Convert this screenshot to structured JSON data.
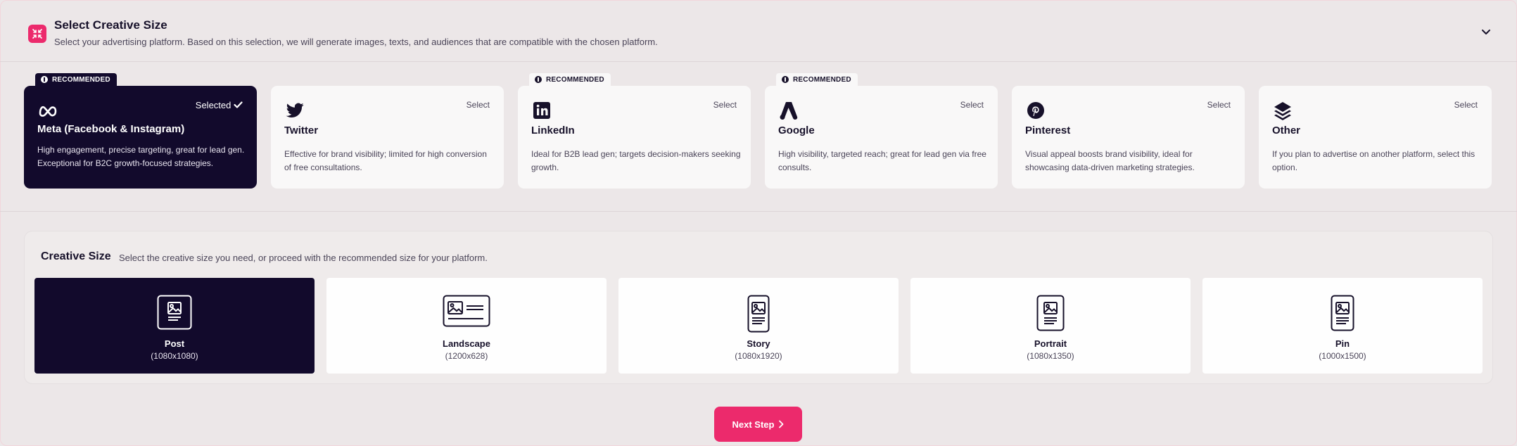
{
  "header": {
    "title": "Select Creative Size",
    "subtitle": "Select your advertising platform. Based on this selection, we will generate images, texts, and audiences that are compatible with the chosen platform.",
    "icon": "shrink-arrows-icon",
    "collapse_icon": "chevron-down-icon"
  },
  "platforms": [
    {
      "name": "Meta (Facebook & Instagram)",
      "select_label": "Selected",
      "selected": true,
      "badge": "RECOMMENDED",
      "icon": "meta-icon",
      "desc": "High engagement, precise targeting, great for lead gen. Exceptional for B2C growth-focused strategies."
    },
    {
      "name": "Twitter",
      "select_label": "Select",
      "selected": false,
      "badge": "",
      "icon": "twitter-icon",
      "desc": "Effective for brand visibility; limited for high conversion of free consultations."
    },
    {
      "name": "LinkedIn",
      "select_label": "Select",
      "selected": false,
      "badge": "RECOMMENDED",
      "icon": "linkedin-icon",
      "desc": "Ideal for B2B lead gen; targets decision-makers seeking growth."
    },
    {
      "name": "Google",
      "select_label": "Select",
      "selected": false,
      "badge": "RECOMMENDED",
      "icon": "google-ads-icon",
      "desc": "High visibility, targeted reach; great for lead gen via free consults."
    },
    {
      "name": "Pinterest",
      "select_label": "Select",
      "selected": false,
      "badge": "",
      "icon": "pinterest-icon",
      "desc": "Visual appeal boosts brand visibility, ideal for showcasing data-driven marketing strategies."
    },
    {
      "name": "Other",
      "select_label": "Select",
      "selected": false,
      "badge": "",
      "icon": "layers-icon",
      "desc": "If you plan to advertise on another platform, select this option."
    }
  ],
  "creative_size": {
    "title": "Creative Size",
    "subtitle": "Select the creative size you need, or proceed with the recommended size for your platform.",
    "sizes": [
      {
        "name": "Post",
        "dims": "(1080x1080)",
        "selected": true,
        "icon": "post-image-icon"
      },
      {
        "name": "Landscape",
        "dims": "(1200x628)",
        "selected": false,
        "icon": "landscape-image-icon"
      },
      {
        "name": "Story",
        "dims": "(1080x1920)",
        "selected": false,
        "icon": "story-image-icon"
      },
      {
        "name": "Portrait",
        "dims": "(1080x1350)",
        "selected": false,
        "icon": "portrait-image-icon"
      },
      {
        "name": "Pin",
        "dims": "(1000x1500)",
        "selected": false,
        "icon": "pin-image-icon"
      }
    ]
  },
  "next_button": {
    "label": "Next Step",
    "icon": "chevron-right-icon"
  },
  "colors": {
    "accent": "#ec2a6c",
    "selected_bg": "#120a2c",
    "page_bg": "#ece7e8",
    "card_bg": "#f9f8f8"
  }
}
